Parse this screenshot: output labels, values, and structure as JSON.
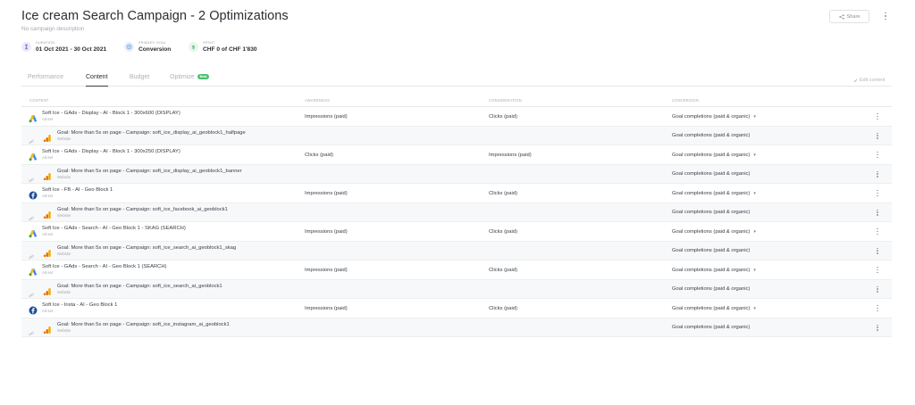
{
  "header": {
    "title": "Ice cream Search Campaign - 2 Optimizations",
    "description": "No campaign description",
    "share_label": "Share"
  },
  "meta": {
    "duration": {
      "label": "Duration",
      "value": "01 Oct 2021 - 30 Oct 2021",
      "color": "#8b7fd6"
    },
    "primary_goal": {
      "label": "Primary goal",
      "value": "Conversion",
      "color": "#5a8fe0"
    },
    "spent": {
      "label": "Spent",
      "value": "CHF 0 of CHF 1'830",
      "color": "#4bbf73"
    }
  },
  "tabs": [
    {
      "label": "Performance",
      "active": false
    },
    {
      "label": "Content",
      "active": true
    },
    {
      "label": "Budget",
      "active": false
    },
    {
      "label": "Optimize",
      "active": false,
      "badge": "Beta"
    }
  ],
  "edit_content_label": "Edit content",
  "table": {
    "columns": [
      "Content",
      "Awareness",
      "Consideration",
      "Conversion"
    ],
    "rows": [
      {
        "kind": "adset",
        "platform": "google-ads-icon",
        "name": "Soft Ice - GAds - Display - AI - Block 1 - 300x600 (DISPLAY)",
        "sub": "Ad-set",
        "awareness": "Impressions (paid)",
        "consideration": "Clicks (paid)",
        "conversion": "Goal completions (paid & organic)",
        "caret": true
      },
      {
        "kind": "goal",
        "name": "Goal: More than 5s on page - Campaign: soft_ice_display_ai_geoblock1_halfpage",
        "sub": "Website",
        "awareness": "",
        "consideration": "",
        "conversion": "Goal completions (paid & organic)",
        "caret": false
      },
      {
        "kind": "adset",
        "platform": "google-ads-icon",
        "name": "Soft Ice - GAds - Display - AI - Block 1 - 300x250 (DISPLAY)",
        "sub": "Ad-set",
        "awareness": "Clicks (paid)",
        "consideration": "Impressions (paid)",
        "conversion": "Goal completions (paid & organic)",
        "caret": true
      },
      {
        "kind": "goal",
        "name": "Goal: More than 5s on page - Campaign: soft_ice_display_ai_geoblock1_banner",
        "sub": "Website",
        "awareness": "",
        "consideration": "",
        "conversion": "Goal completions (paid & organic)",
        "caret": false
      },
      {
        "kind": "adset",
        "platform": "facebook-icon",
        "name": "Soft Ice - FB - AI - Geo Block 1",
        "sub": "Ad-set",
        "awareness": "Impressions (paid)",
        "consideration": "Clicks (paid)",
        "conversion": "Goal completions (paid & organic)",
        "caret": true
      },
      {
        "kind": "goal",
        "name": "Goal: More than 5s on page - Campaign: soft_ice_facebook_ai_geoblock1",
        "sub": "Website",
        "awareness": "",
        "consideration": "",
        "conversion": "Goal completions (paid & organic)",
        "caret": false
      },
      {
        "kind": "adset",
        "platform": "google-ads-icon",
        "name": "Soft Ice - GAds - Search - AI - Geo Block 1 - SKAG (SEARCH)",
        "sub": "Ad-set",
        "awareness": "Impressions (paid)",
        "consideration": "Clicks (paid)",
        "conversion": "Goal completions (paid & organic)",
        "caret": true
      },
      {
        "kind": "goal",
        "name": "Goal: More than 5s on page - Campaign: soft_ice_search_ai_geoblock1_skag",
        "sub": "Website",
        "awareness": "",
        "consideration": "",
        "conversion": "Goal completions (paid & organic)",
        "caret": false
      },
      {
        "kind": "adset",
        "platform": "google-ads-icon",
        "name": "Soft Ice - GAds - Search - AI - Geo Block 1 (SEARCH)",
        "sub": "Ad-set",
        "awareness": "Impressions (paid)",
        "consideration": "Clicks (paid)",
        "conversion": "Goal completions (paid & organic)",
        "caret": true
      },
      {
        "kind": "goal",
        "name": "Goal: More than 5s on page - Campaign: soft_ice_search_ai_geoblock1",
        "sub": "Website",
        "awareness": "",
        "consideration": "",
        "conversion": "Goal completions (paid & organic)",
        "caret": false
      },
      {
        "kind": "adset",
        "platform": "facebook-icon",
        "name": "Soft Ice - Insta - AI - Geo Block 1",
        "sub": "Ad-set",
        "awareness": "Impressions (paid)",
        "consideration": "Clicks (paid)",
        "conversion": "Goal completions (paid & organic)",
        "caret": true
      },
      {
        "kind": "goal",
        "name": "Goal: More than 5s on page - Campaign: soft_ice_instagram_ai_geoblock1",
        "sub": "Website",
        "awareness": "",
        "consideration": "",
        "conversion": "Goal completions (paid & organic)",
        "caret": false
      }
    ]
  }
}
